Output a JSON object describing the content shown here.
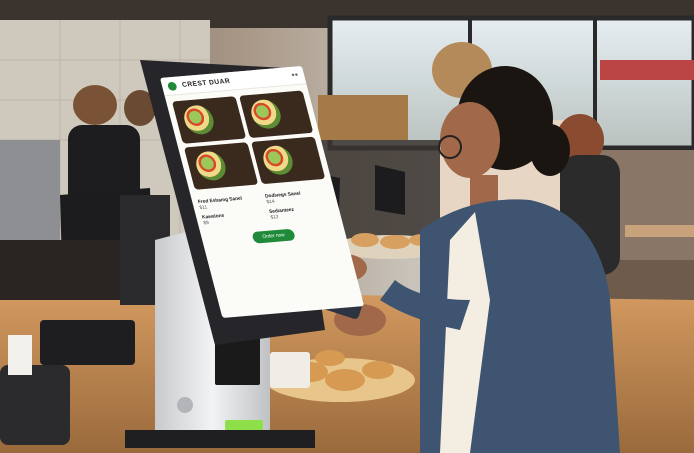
{
  "scene": {
    "description_colors": {
      "wall": "#d9d3c9",
      "counter": "#c58f5a",
      "kiosk_body": "#e9eaec",
      "kiosk_frame": "#2b2b2f",
      "accent_green": "#1f8a3a"
    }
  },
  "kiosk": {
    "title": "CREST DUAR",
    "dishes": [
      "dish-1",
      "dish-2",
      "dish-3",
      "dish-4"
    ],
    "items": [
      {
        "name": "Fred Eshamg Sanel",
        "price": "$11"
      },
      {
        "name": "Dodivegs Sanel",
        "price": "$14"
      },
      {
        "name": "Kawslons",
        "price": "$9"
      },
      {
        "name": "Sedianteez",
        "price": "$12"
      }
    ],
    "button_label": "Order now"
  }
}
